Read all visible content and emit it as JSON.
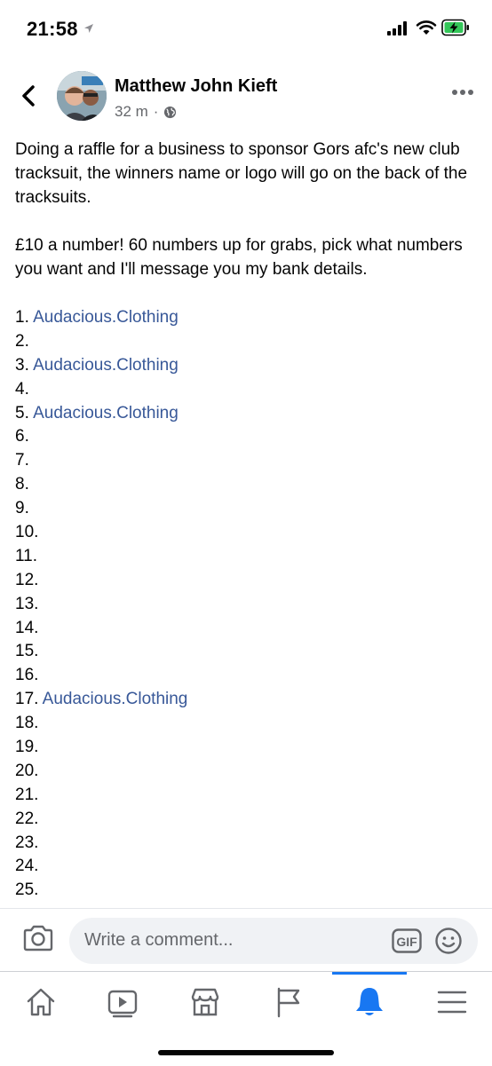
{
  "status_bar": {
    "time": "21:58",
    "icons": [
      "location-arrow-icon",
      "signal-icon",
      "wifi-icon",
      "battery-charging-icon"
    ],
    "battery_color": "#34c759"
  },
  "post": {
    "author": "Matthew John Kieft",
    "time_ago": "32 m",
    "separator": "·",
    "audience_icon": "globe-icon",
    "paragraphs": [
      "Doing a raffle for a business to sponsor Gors afc's new club tracksuit, the winners name or logo will go on the back of the tracksuits.",
      "£10 a number! 60 numbers up for grabs, pick what numbers you want and I'll message you my bank details."
    ],
    "raffle_entries": [
      {
        "number": "1.",
        "name": "Audacious.Clothing"
      },
      {
        "number": "2.",
        "name": ""
      },
      {
        "number": "3.",
        "name": "Audacious.Clothing"
      },
      {
        "number": "4.",
        "name": ""
      },
      {
        "number": "5.",
        "name": "Audacious.Clothing"
      },
      {
        "number": "6.",
        "name": ""
      },
      {
        "number": "7.",
        "name": ""
      },
      {
        "number": "8.",
        "name": ""
      },
      {
        "number": "9.",
        "name": ""
      },
      {
        "number": "10.",
        "name": ""
      },
      {
        "number": "11.",
        "name": ""
      },
      {
        "number": "12.",
        "name": ""
      },
      {
        "number": "13.",
        "name": ""
      },
      {
        "number": "14.",
        "name": ""
      },
      {
        "number": "15.",
        "name": ""
      },
      {
        "number": "16.",
        "name": ""
      },
      {
        "number": "17.",
        "name": "Audacious.Clothing"
      },
      {
        "number": "18.",
        "name": ""
      },
      {
        "number": "19.",
        "name": ""
      },
      {
        "number": "20.",
        "name": ""
      },
      {
        "number": "21.",
        "name": ""
      },
      {
        "number": "22.",
        "name": ""
      },
      {
        "number": "23.",
        "name": ""
      },
      {
        "number": "24.",
        "name": ""
      },
      {
        "number": "25.",
        "name": ""
      }
    ],
    "link_color": "#385898"
  },
  "comment_bar": {
    "placeholder": "Write a comment...",
    "gif_label": "GIF"
  },
  "bottom_nav": {
    "items": [
      "home-icon",
      "video-icon",
      "marketplace-icon",
      "pages-flag-icon",
      "notifications-bell-icon",
      "menu-icon"
    ],
    "active": "notifications-bell-icon",
    "active_color": "#1877f2"
  }
}
